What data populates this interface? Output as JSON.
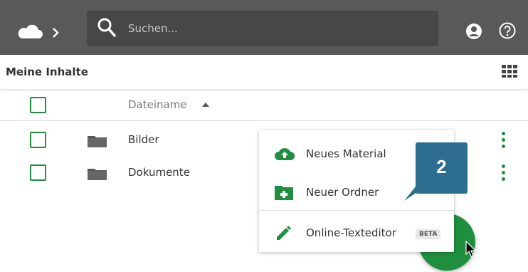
{
  "search": {
    "placeholder": "Suchen..."
  },
  "breadcrumb": {
    "title": "Meine Inhalte"
  },
  "table": {
    "column_name": "Dateiname",
    "rows": [
      {
        "name": "Bilder"
      },
      {
        "name": "Dokumente"
      }
    ]
  },
  "menu": {
    "items": [
      {
        "label": "Neues Material",
        "icon": "cloud-upload-icon"
      },
      {
        "label": "Neuer Ordner",
        "icon": "folder-plus-icon"
      },
      {
        "label": "Online-Texteditor",
        "icon": "pencil-icon",
        "badge": "BETA"
      }
    ]
  },
  "step_badge": "2",
  "colors": {
    "topbar": "#595959",
    "search": "#474747",
    "accent": "#1f8f3f",
    "step": "#2d6d90"
  }
}
